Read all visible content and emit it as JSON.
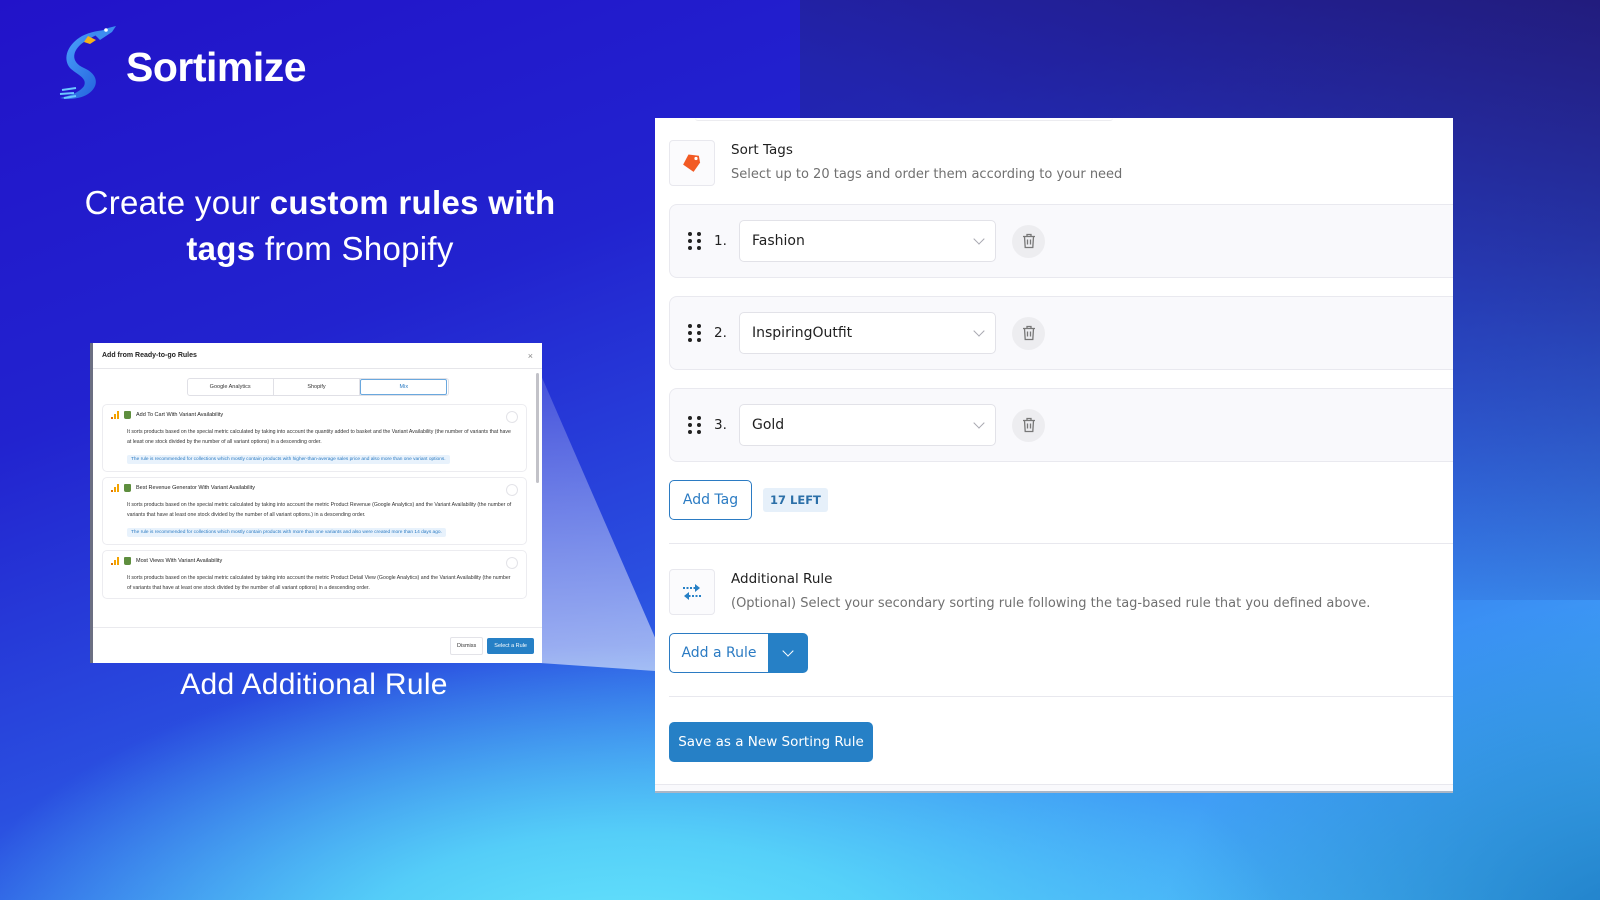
{
  "brand": {
    "name": "Sortimize"
  },
  "headline": {
    "part1": "Create your ",
    "bold1": "custom rules with",
    "bold2": "tags",
    "part2": " from Shopify"
  },
  "modal": {
    "title": "Add from Ready-to-go Rules",
    "close": "×",
    "tabs": [
      {
        "label": "Google Analytics",
        "active": false
      },
      {
        "label": "Shopify",
        "active": false
      },
      {
        "label": "Mix",
        "active": true
      }
    ],
    "rules": [
      {
        "title": "Add To Cart With Variant Availability",
        "description": "It sorts products based on the special metric calculated by taking into account the quantity added to basket and the Variant Availability (the number of variants that have at least one stock divided by the number of all variant options) in a descending order.",
        "note": "The rule is recommended for collections which mostly contain products with higher-than-average sales price and also more than one variant options."
      },
      {
        "title": "Best Revenue Generator With Variant Availability",
        "description": "It sorts products based on the special metric calculated by taking into account the metric Product Revenue (Google Analytics) and the Variant Availability (the number of variants that have at least one stock divided by the number of all variant options.) in a descending order.",
        "note": "The rule is recommended for collections which mostly contain products with more than one variants and also were created more than 14 days ago."
      },
      {
        "title": "Most Views With Variant Availability",
        "description": "It sorts products based on the special metric calculated by taking into account the metric Product Detail View (Google Analytics) and the Variant Availability (the number of variants that have at least one stock divided by the number of all variant options) in a descending order.",
        "note": ""
      }
    ],
    "dismiss_label": "Dismiss",
    "select_label": "Select a Rule"
  },
  "caption": "Add Additional Rule",
  "panel": {
    "sort_tags": {
      "title": "Sort Tags",
      "subtitle": "Select up to 20 tags and order them according to your need"
    },
    "tags": [
      {
        "index": "1.",
        "value": "Fashion"
      },
      {
        "index": "2.",
        "value": "InspiringOutfit"
      },
      {
        "index": "3.",
        "value": "Gold"
      }
    ],
    "add_tag_label": "Add Tag",
    "tags_left_badge": "17 LEFT",
    "additional_rule": {
      "title": "Additional Rule",
      "subtitle": "(Optional) Select your secondary sorting rule following the tag-based rule that you defined above."
    },
    "add_rule_label": "Add a Rule",
    "save_label": "Save as a New Sorting Rule"
  },
  "colors": {
    "accent": "#2680c6",
    "tag_icon": "#f25a24"
  }
}
